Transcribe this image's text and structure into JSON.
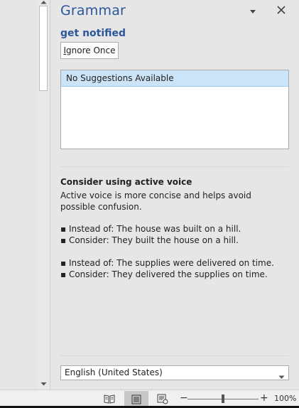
{
  "pane": {
    "title": "Grammar",
    "error_text": "get notified",
    "ignore_button": {
      "prefix": "I",
      "rest": "gnore Once"
    },
    "suggestions": [
      "No Suggestions Available"
    ],
    "explanation": {
      "title": "Consider using active voice",
      "body": "Active voice is more concise and helps avoid possible confusion.",
      "examples": [
        "▪ Instead of: The house was built on a hill.",
        "▪ Consider: They built the house on a hill.",
        "▪ Instead of: The supplies were delivered on time.",
        "▪ Consider: They delivered the supplies on time."
      ]
    },
    "language": "English (United States)"
  },
  "statusbar": {
    "zoom_minus": "−",
    "zoom_plus": "+",
    "zoom_percent": "100%",
    "zoom_level": 100
  },
  "colors": {
    "accent": "#2b579a",
    "selection": "#cce4f7",
    "pane_bg": "#e6e6e6"
  },
  "icons": [
    "pane-options-icon",
    "close-icon",
    "read-mode-icon",
    "print-layout-icon",
    "web-layout-icon",
    "dropdown-chevron-icon"
  ]
}
